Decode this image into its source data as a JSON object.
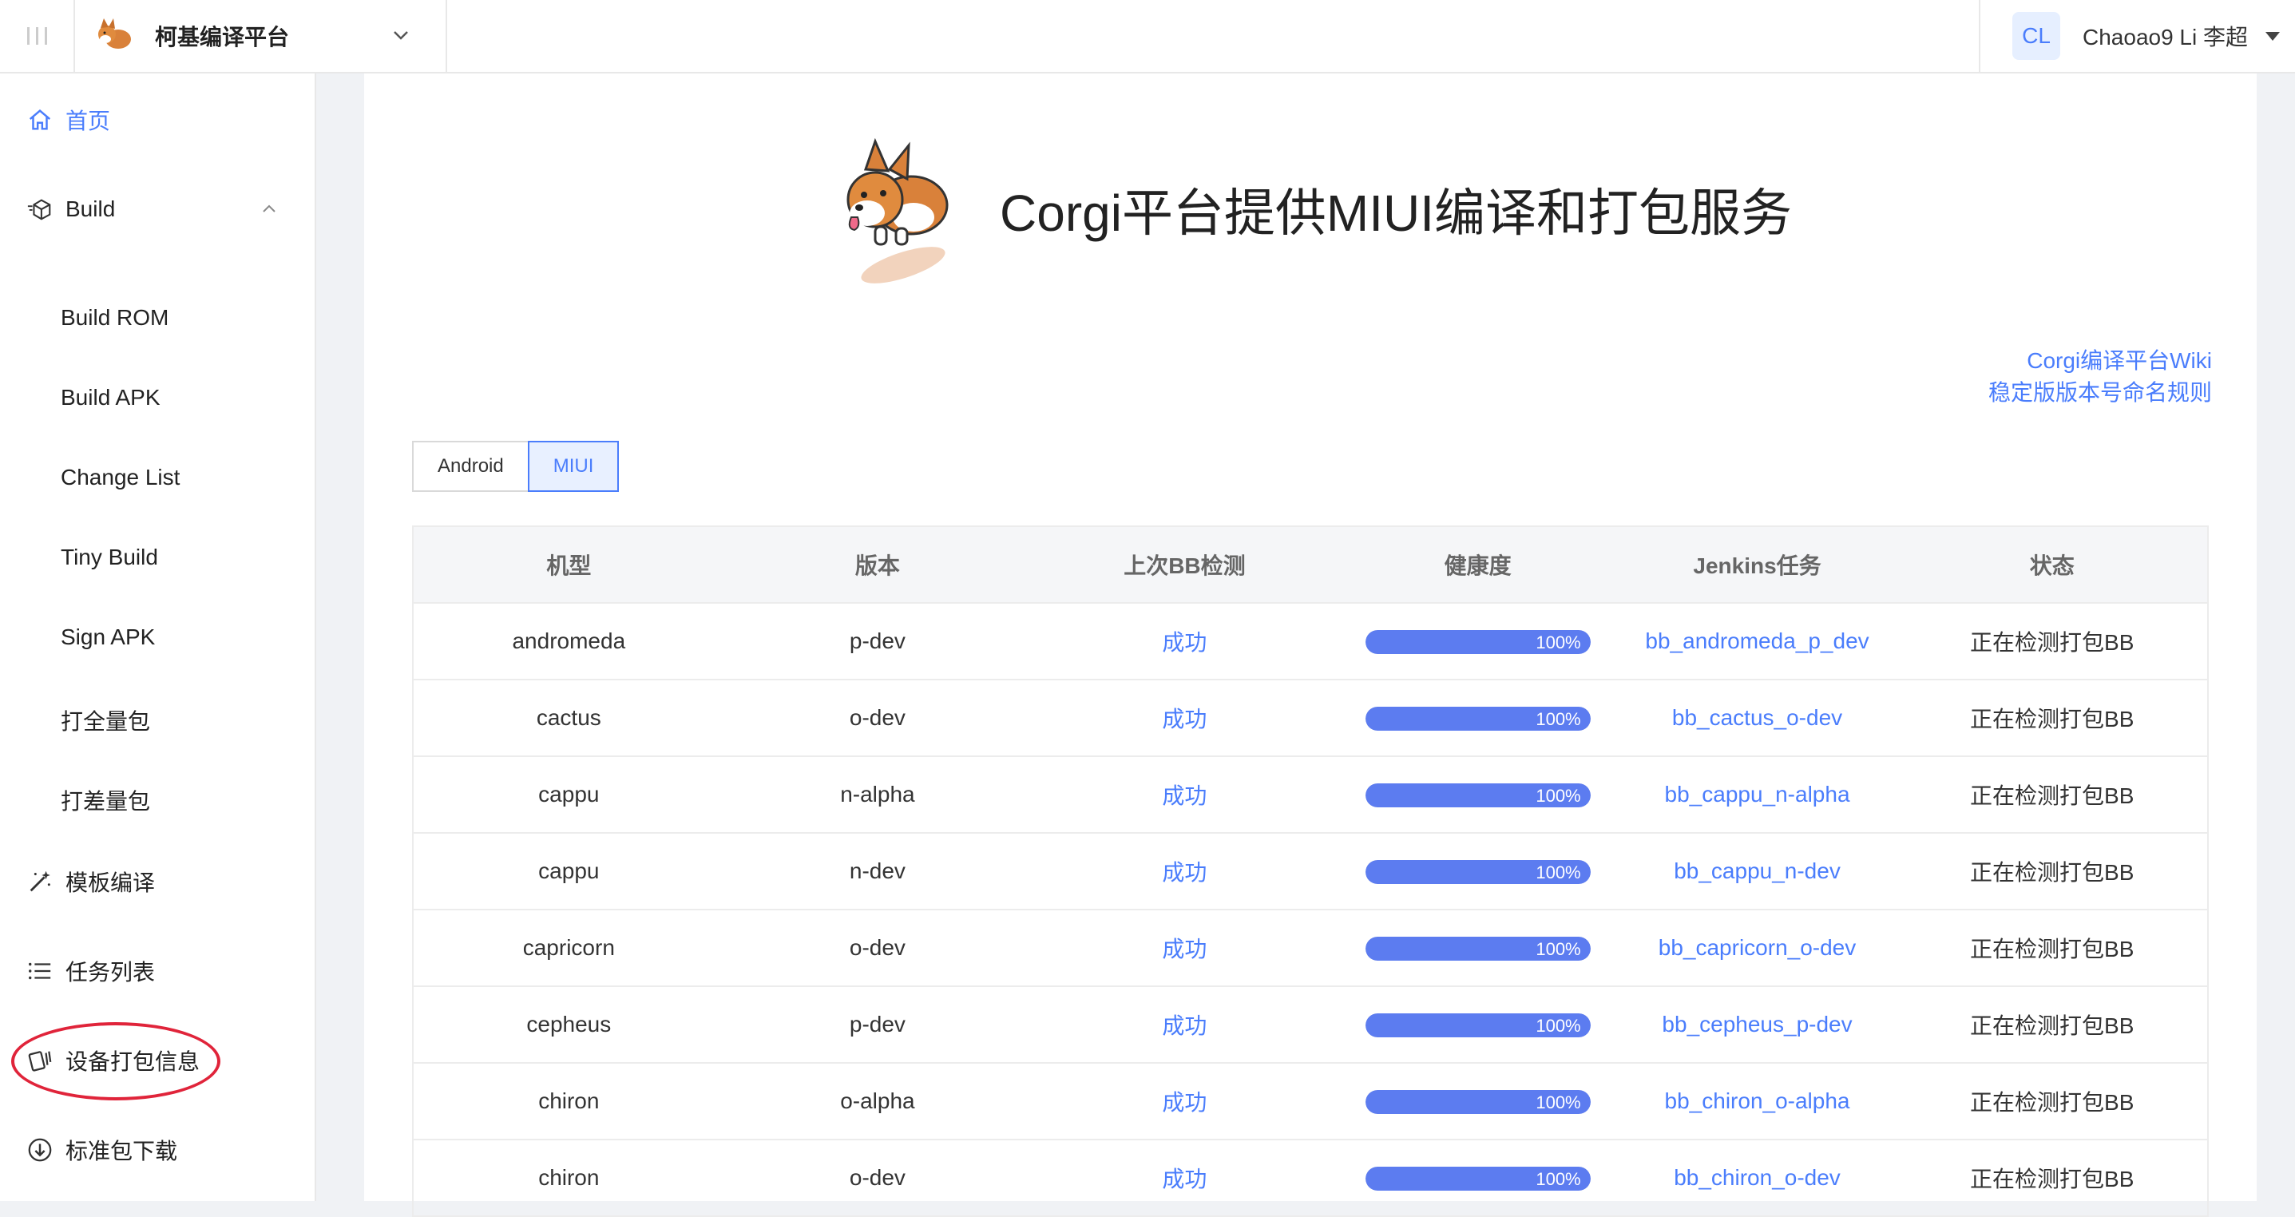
{
  "app": {
    "brand_name": "柯基编译平台",
    "user_initials": "CL",
    "user_name": "Chaoao9 Li 李超"
  },
  "sidebar": {
    "home": "首页",
    "build": "Build",
    "build_items": [
      "Build ROM",
      "Build APK",
      "Change List",
      "Tiny Build",
      "Sign APK",
      "打全量包",
      "打差量包"
    ],
    "template_compile": "模板编译",
    "task_list": "任务列表",
    "device_pack_info": "设备打包信息",
    "std_pack_download": "标准包下载"
  },
  "hero": {
    "title": "Corgi平台提供MIUI编译和打包服务"
  },
  "links": {
    "wiki": "Corgi编译平台Wiki",
    "naming": "稳定版版本号命名规则"
  },
  "tabs": {
    "android": "Android",
    "miui": "MIUI",
    "selected": "MIUI"
  },
  "table": {
    "headers": [
      "机型",
      "版本",
      "上次BB检测",
      "健康度",
      "Jenkins任务",
      "状态"
    ],
    "rows": [
      {
        "device": "andromeda",
        "version": "p-dev",
        "bb": "成功",
        "health": 100,
        "health_label": "100%",
        "job": "bb_andromeda_p_dev",
        "status": "正在检测打包BB"
      },
      {
        "device": "cactus",
        "version": "o-dev",
        "bb": "成功",
        "health": 100,
        "health_label": "100%",
        "job": "bb_cactus_o-dev",
        "status": "正在检测打包BB"
      },
      {
        "device": "cappu",
        "version": "n-alpha",
        "bb": "成功",
        "health": 100,
        "health_label": "100%",
        "job": "bb_cappu_n-alpha",
        "status": "正在检测打包BB"
      },
      {
        "device": "cappu",
        "version": "n-dev",
        "bb": "成功",
        "health": 100,
        "health_label": "100%",
        "job": "bb_cappu_n-dev",
        "status": "正在检测打包BB"
      },
      {
        "device": "capricorn",
        "version": "o-dev",
        "bb": "成功",
        "health": 100,
        "health_label": "100%",
        "job": "bb_capricorn_o-dev",
        "status": "正在检测打包BB"
      },
      {
        "device": "cepheus",
        "version": "p-dev",
        "bb": "成功",
        "health": 100,
        "health_label": "100%",
        "job": "bb_cepheus_p-dev",
        "status": "正在检测打包BB"
      },
      {
        "device": "chiron",
        "version": "o-alpha",
        "bb": "成功",
        "health": 100,
        "health_label": "100%",
        "job": "bb_chiron_o-alpha",
        "status": "正在检测打包BB"
      },
      {
        "device": "chiron",
        "version": "o-dev",
        "bb": "成功",
        "health": 100,
        "health_label": "100%",
        "job": "bb_chiron_o-dev",
        "status": "正在检测打包BB"
      }
    ]
  },
  "colors": {
    "accent": "#4a7dfc",
    "progress": "#5c7cf0",
    "highlight": "#e0243a"
  }
}
